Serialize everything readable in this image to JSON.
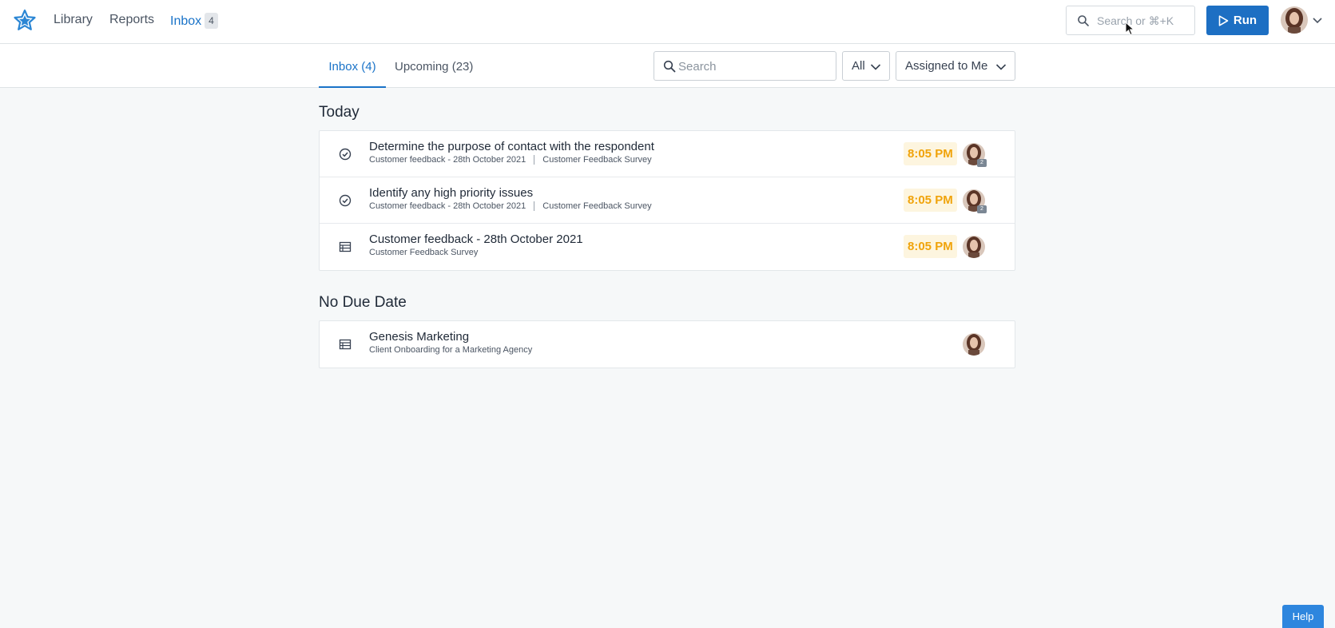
{
  "nav": {
    "links": [
      {
        "label": "Library"
      },
      {
        "label": "Reports"
      },
      {
        "label": "Inbox",
        "badge": "4"
      }
    ],
    "search_placeholder": "Search or ⌘+K",
    "run_label": "Run",
    "logo_icon": "star-logo-icon",
    "accent_color": "#1a73c8"
  },
  "tabs": [
    {
      "label": "Inbox (4)",
      "active": true
    },
    {
      "label": "Upcoming (23)",
      "active": false
    }
  ],
  "filters": {
    "search_placeholder": "Search",
    "type_selected": "All",
    "assignee_selected": "Assigned to Me"
  },
  "sections": [
    {
      "title": "Today",
      "items": [
        {
          "icon": "check-circle-icon",
          "title": "Determine the purpose of contact with the respondent",
          "meta1": "Customer feedback - 28th October 2021",
          "meta2": "Customer Feedback Survey",
          "time": "8:05 PM",
          "count": "2"
        },
        {
          "icon": "check-circle-icon",
          "title": "Identify any high priority issues",
          "meta1": "Customer feedback - 28th October 2021",
          "meta2": "Customer Feedback Survey",
          "time": "8:05 PM",
          "count": "2"
        },
        {
          "icon": "table-icon",
          "title": "Customer feedback - 28th October 2021",
          "meta1": "Customer Feedback Survey",
          "time": "8:05 PM"
        }
      ]
    },
    {
      "title": "No Due Date",
      "items": [
        {
          "icon": "table-icon",
          "title": "Genesis Marketing",
          "meta1": "Client Onboarding for a Marketing Agency"
        }
      ]
    }
  ],
  "help_label": "Help",
  "colors": {
    "time_text": "#f0a30a",
    "time_bg": "#fdf5df",
    "run_bg": "#1d6fc3"
  }
}
